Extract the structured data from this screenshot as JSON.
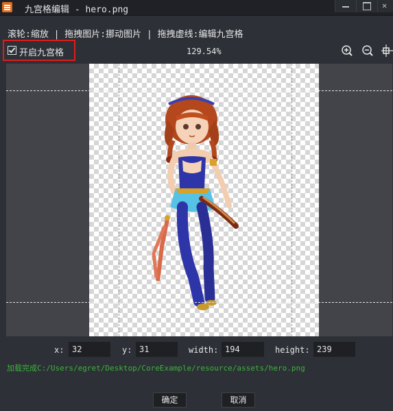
{
  "window": {
    "title": "九宫格编辑 - hero.png",
    "icon": "app-icon",
    "controls": [
      "minimize-icon",
      "maximize-icon",
      "close-icon"
    ]
  },
  "hint": "滚轮:缩放 | 拖拽图片:挪动图片 | 拖拽虚线:编辑九宫格",
  "toolbar": {
    "enable_label": "开启九宫格",
    "enabled": true,
    "zoom_text": "129.54%",
    "tools": [
      "zoom-in-icon",
      "zoom-out-icon",
      "fit-icon"
    ]
  },
  "fields": {
    "x_label": "x:",
    "x_value": "32",
    "y_label": "y:",
    "y_value": "31",
    "width_label": "width:",
    "width_value": "194",
    "height_label": "height:",
    "height_value": "239"
  },
  "status": "加载完成C:/Users/egret/Desktop/CoreExample/resource/assets/hero.png",
  "buttons": {
    "ok": "确定",
    "cancel": "取消"
  },
  "colors": {
    "highlight_border": "#e01c1c",
    "status_text": "#3cb43c",
    "accent_icon": "#e06c1d"
  }
}
